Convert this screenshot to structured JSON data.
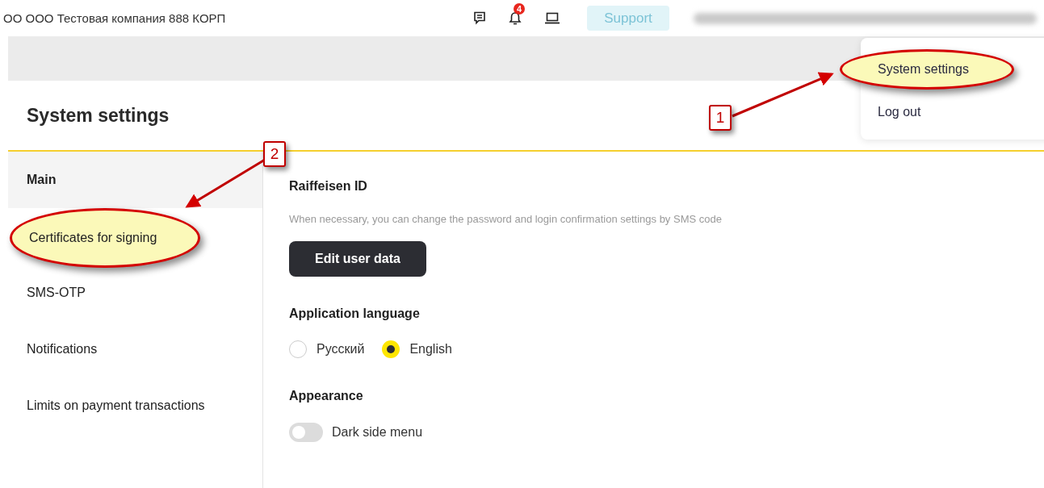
{
  "header": {
    "company": "ОО ООО Тестовая компания 888 КОРП",
    "notification_count": "4",
    "support_button": "Support"
  },
  "user_menu": {
    "items": [
      {
        "label": "System settings",
        "highlighted": true
      },
      {
        "label": "Log out",
        "highlighted": false
      }
    ]
  },
  "page": {
    "title": "System settings"
  },
  "sidebar": {
    "items": [
      {
        "label": "Main",
        "selected": true,
        "highlighted": false
      },
      {
        "label": "Certificates for signing",
        "selected": false,
        "highlighted": true
      },
      {
        "label": "SMS-OTP",
        "selected": false,
        "highlighted": false
      },
      {
        "label": "Notifications",
        "selected": false,
        "highlighted": false
      },
      {
        "label": "Limits on payment transactions",
        "selected": false,
        "highlighted": false
      }
    ]
  },
  "content": {
    "sections": [
      {
        "kind": "button",
        "title": "Raiffeisen ID",
        "description": "When necessary, you can change the password and login confirmation settings by SMS code",
        "button": "Edit user data"
      },
      {
        "kind": "radio",
        "title": "Application language",
        "options": [
          {
            "label": "Русский",
            "selected": false
          },
          {
            "label": "English",
            "selected": true
          }
        ]
      },
      {
        "kind": "toggle",
        "title": "Appearance",
        "label": "Dark side menu",
        "on": false
      }
    ]
  },
  "annotations": [
    {
      "label": "1"
    },
    {
      "label": "2"
    }
  ]
}
